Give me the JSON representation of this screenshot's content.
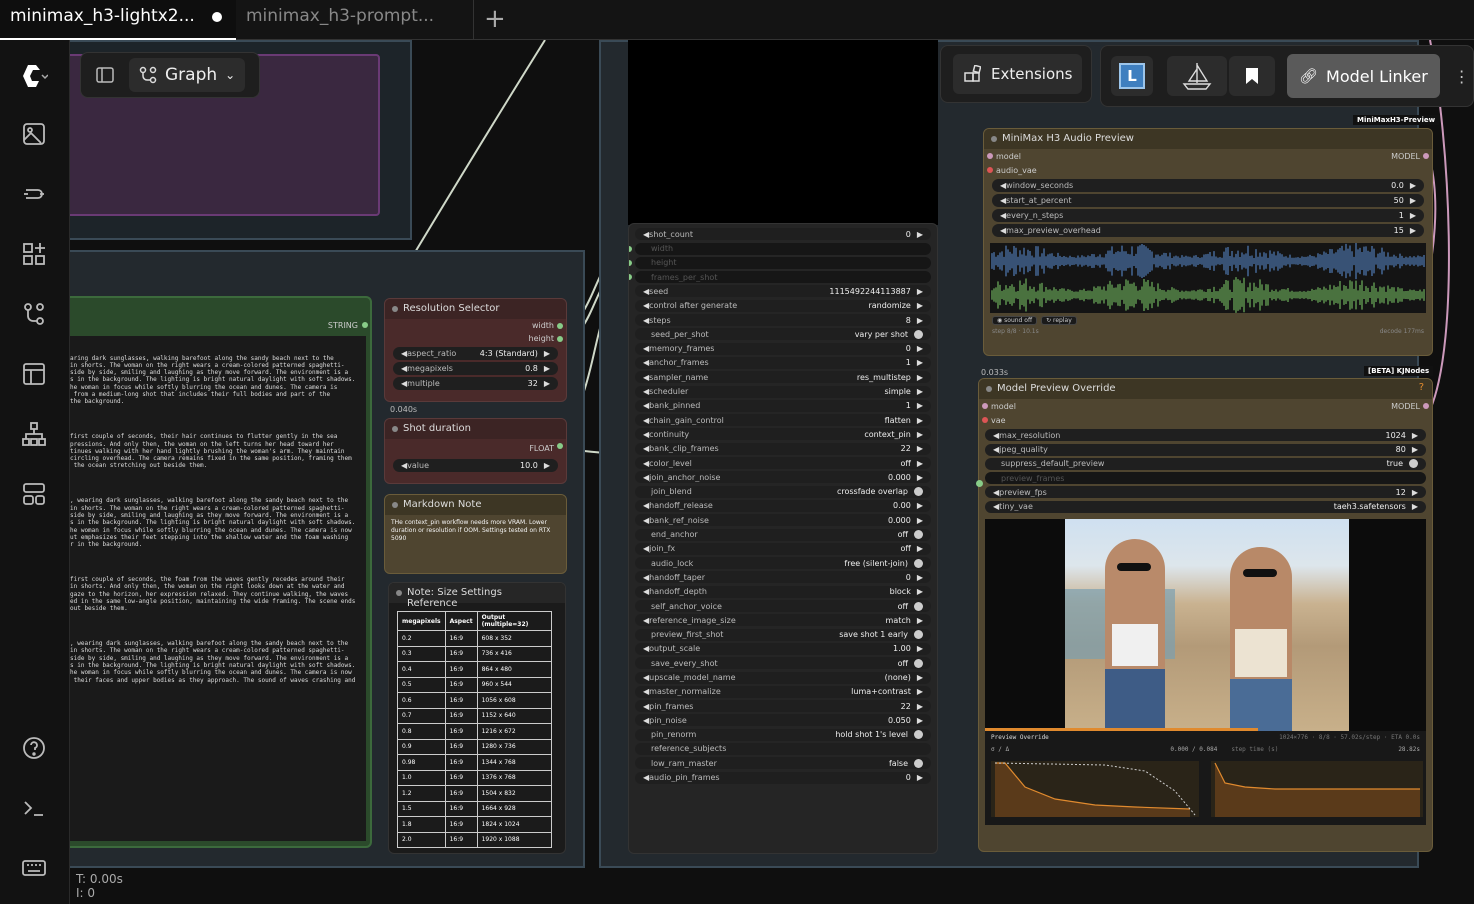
{
  "tabs": [
    {
      "label": "minimax_h3-lightx2...",
      "active": true,
      "modified": true
    },
    {
      "label": "minimax_h3-prompt...",
      "active": false
    }
  ],
  "new_tab": "+",
  "toolbar": {
    "graph_label": "Graph",
    "extensions_label": "Extensions",
    "model_linker_label": "Model Linker",
    "logo_letter": "L"
  },
  "status": {
    "time": "T: 0.00s",
    "items": "I: 0"
  },
  "prompt_text": {
    "port_label": "STRING",
    "paragraphs": [
      "aring dark sunglasses, walking barefoot along the sandy beach next to the\nin shorts. The woman on the right wears a cream-colored patterned spaghetti-\nside by side, smiling and laughing as they move forward. The environment is a\ns in the background. The lighting is bright natural daylight with soft shadows.\nhe woman in focus while softly blurring the ocean and dunes. The camera is\n from a medium-long shot that includes their full bodies and part of the\nthe background.",
      "first couple of seconds, their hair continues to flutter gently in the sea\npressions. And only then, the woman on the left turns her head toward her\ntinues walking with her hand lightly brushing the woman's arm. They maintain\ncircling overhead. The camera remains fixed in the same position, framing them\n the ocean stretching out beside them.",
      ", wearing dark sunglasses, walking barefoot along the sandy beach next to the\nin shorts. The woman on the right wears a cream-colored patterned spaghetti-\nside by side, smiling and laughing as they move forward. The environment is a\ns in the background. The lighting is bright natural daylight with soft shadows.\nhe woman in focus while softly blurring the ocean and dunes. The camera is now\nut emphasizes their feet stepping into the shallow water and the foam washing\nr in the background.",
      "first couple of seconds, the foam from the waves gently recedes around their\nin shorts. And only then, the woman on the right looks down at the water and\ngaze to the horizon, her expression relaxed. They continue walking, the waves\ned in the same low-angle position, maintaining the wide framing. The scene ends\nout beside them.",
      ", wearing dark sunglasses, walking barefoot along the sandy beach next to the\nin shorts. The woman on the right wears a cream-colored patterned spaghetti-\nside by side, smiling and laughing as they move forward. The environment is a\ns in the background. The lighting is bright natural daylight with soft shadows.\nhe woman in focus while softly blurring the ocean and dunes. The camera is now\n their faces and upper bodies as they approach. The sound of waves crashing and"
    ]
  },
  "resolution_selector": {
    "title": "Resolution Selector",
    "outputs": [
      "width",
      "height"
    ],
    "widgets": [
      {
        "key": "aspect_ratio",
        "value": "4:3 (Standard)"
      },
      {
        "key": "megapixels",
        "value": "0.8"
      },
      {
        "key": "multiple",
        "value": "32"
      }
    ],
    "timing": "0.040s"
  },
  "shot_duration": {
    "title": "Shot duration",
    "output": "FLOAT",
    "widget": {
      "key": "value",
      "value": "10.0"
    }
  },
  "markdown_note": {
    "title": "Markdown Note",
    "text": "THe context_pin workflow needs more VRAM. Lower duration or resolution if OOM. Settings tested on RTX 5090"
  },
  "size_note": {
    "title": "Note: Size Settings Reference",
    "headers": [
      "megapixels",
      "Aspect",
      "Output (multiple=32)"
    ],
    "rows": [
      [
        "0.2",
        "16:9",
        "608 x 352"
      ],
      [
        "0.3",
        "16:9",
        "736 x 416"
      ],
      [
        "0.4",
        "16:9",
        "864 x 480"
      ],
      [
        "0.5",
        "16:9",
        "960 x 544"
      ],
      [
        "0.6",
        "16:9",
        "1056 x 608"
      ],
      [
        "0.7",
        "16:9",
        "1152 x 640"
      ],
      [
        "0.8",
        "16:9",
        "1216 x 672"
      ],
      [
        "0.9",
        "16:9",
        "1280 x 736"
      ],
      [
        "0.98",
        "16:9",
        "1344 x 768"
      ],
      [
        "1.0",
        "16:9",
        "1376 x 768"
      ],
      [
        "1.2",
        "16:9",
        "1504 x 832"
      ],
      [
        "1.5",
        "16:9",
        "1664 x 928"
      ],
      [
        "1.8",
        "16:9",
        "1824 x 1024"
      ],
      [
        "2.0",
        "16:9",
        "1920 x 1088"
      ]
    ]
  },
  "main_node": {
    "widgets": [
      {
        "key": "shot_count",
        "value": "0",
        "type": "num"
      },
      {
        "key": "width",
        "value": "",
        "type": "disabled"
      },
      {
        "key": "height",
        "value": "",
        "type": "disabled"
      },
      {
        "key": "frames_per_shot",
        "value": "",
        "type": "disabled"
      },
      {
        "key": "seed",
        "value": "1115492244113887",
        "type": "num"
      },
      {
        "key": "control after generate",
        "value": "randomize",
        "type": "num"
      },
      {
        "key": "steps",
        "value": "8",
        "type": "num"
      },
      {
        "key": "seed_per_shot",
        "value": "vary per shot",
        "type": "toggle"
      },
      {
        "key": "memory_frames",
        "value": "0",
        "type": "num"
      },
      {
        "key": "anchor_frames",
        "value": "1",
        "type": "num"
      },
      {
        "key": "sampler_name",
        "value": "res_multistep",
        "type": "num"
      },
      {
        "key": "scheduler",
        "value": "simple",
        "type": "num"
      },
      {
        "key": "bank_pinned",
        "value": "1",
        "type": "num"
      },
      {
        "key": "chain_gain_control",
        "value": "flatten",
        "type": "num"
      },
      {
        "key": "continuity",
        "value": "context_pin",
        "type": "num"
      },
      {
        "key": "bank_clip_frames",
        "value": "22",
        "type": "num"
      },
      {
        "key": "color_level",
        "value": "off",
        "type": "num"
      },
      {
        "key": "join_anchor_noise",
        "value": "0.000",
        "type": "num"
      },
      {
        "key": "join_blend",
        "value": "crossfade overlap",
        "type": "toggle"
      },
      {
        "key": "handoff_release",
        "value": "0.00",
        "type": "num"
      },
      {
        "key": "bank_ref_noise",
        "value": "0.000",
        "type": "num"
      },
      {
        "key": "end_anchor",
        "value": "off",
        "type": "toggle"
      },
      {
        "key": "join_fx",
        "value": "off",
        "type": "num"
      },
      {
        "key": "audio_lock",
        "value": "free (silent-join)",
        "type": "toggle"
      },
      {
        "key": "handoff_taper",
        "value": "0",
        "type": "num"
      },
      {
        "key": "handoff_depth",
        "value": "block",
        "type": "num"
      },
      {
        "key": "self_anchor_voice",
        "value": "off",
        "type": "toggle"
      },
      {
        "key": "reference_image_size",
        "value": "match",
        "type": "num"
      },
      {
        "key": "preview_first_shot",
        "value": "save shot 1 early",
        "type": "toggle"
      },
      {
        "key": "output_scale",
        "value": "1.00",
        "type": "num"
      },
      {
        "key": "save_every_shot",
        "value": "off",
        "type": "toggle"
      },
      {
        "key": "upscale_model_name",
        "value": "(none)",
        "type": "num"
      },
      {
        "key": "master_normalize",
        "value": "luma+contrast",
        "type": "num"
      },
      {
        "key": "pin_frames",
        "value": "22",
        "type": "num"
      },
      {
        "key": "pin_noise",
        "value": "0.050",
        "type": "num"
      },
      {
        "key": "pin_renorm",
        "value": "hold shot 1's level",
        "type": "toggle"
      },
      {
        "key": "reference_subjects",
        "value": "",
        "type": "text"
      },
      {
        "key": "low_ram_master",
        "value": "false",
        "type": "toggle"
      },
      {
        "key": "audio_pin_frames",
        "value": "0",
        "type": "num"
      }
    ]
  },
  "audio_preview": {
    "badge": "MiniMaxH3-Preview",
    "title": "MiniMax H3 Audio Preview",
    "inputs": [
      "model",
      "audio_vae"
    ],
    "output": "MODEL",
    "widgets": [
      {
        "key": "window_seconds",
        "value": "0.0"
      },
      {
        "key": "start_at_percent",
        "value": "50"
      },
      {
        "key": "every_n_steps",
        "value": "1"
      },
      {
        "key": "max_preview_overhead",
        "value": "15"
      }
    ],
    "sound_btn": "sound off",
    "replay_btn": "replay",
    "step_info": "step 8/8 · 10.1s",
    "decode_info": "decode 177ms",
    "timing": "0.033s"
  },
  "preview_override": {
    "badge": "[BETA] KJNodes",
    "title": "Model Preview Override",
    "help": "?",
    "inputs": [
      "model",
      "vae"
    ],
    "output": "MODEL",
    "widgets": [
      {
        "key": "max_resolution",
        "value": "1024",
        "type": "num"
      },
      {
        "key": "jpeg_quality",
        "value": "80",
        "type": "num"
      },
      {
        "key": "suppress_default_preview",
        "value": "true",
        "type": "toggle"
      },
      {
        "key": "preview_frames",
        "value": "",
        "type": "disabled"
      },
      {
        "key": "preview_fps",
        "value": "12",
        "type": "num"
      },
      {
        "key": "tiny_vae",
        "value": "taeh3.safetensors",
        "type": "num"
      }
    ],
    "footer_title": "Preview Override",
    "footer_info": "1024×776 · 8/8 · 57.02s/step · ETA 0.0s",
    "sigma_label": "σ / Δ",
    "sigma_value": "0.000 / 0.084",
    "step_time_label": "step time (s)",
    "step_time_value": "28.82s",
    "progress": 0.62
  },
  "colors": {
    "node_olive": "#4f4530",
    "node_red": "#4a2a2a",
    "node_green": "#2d4a2d",
    "accent": "#e08a2e"
  }
}
